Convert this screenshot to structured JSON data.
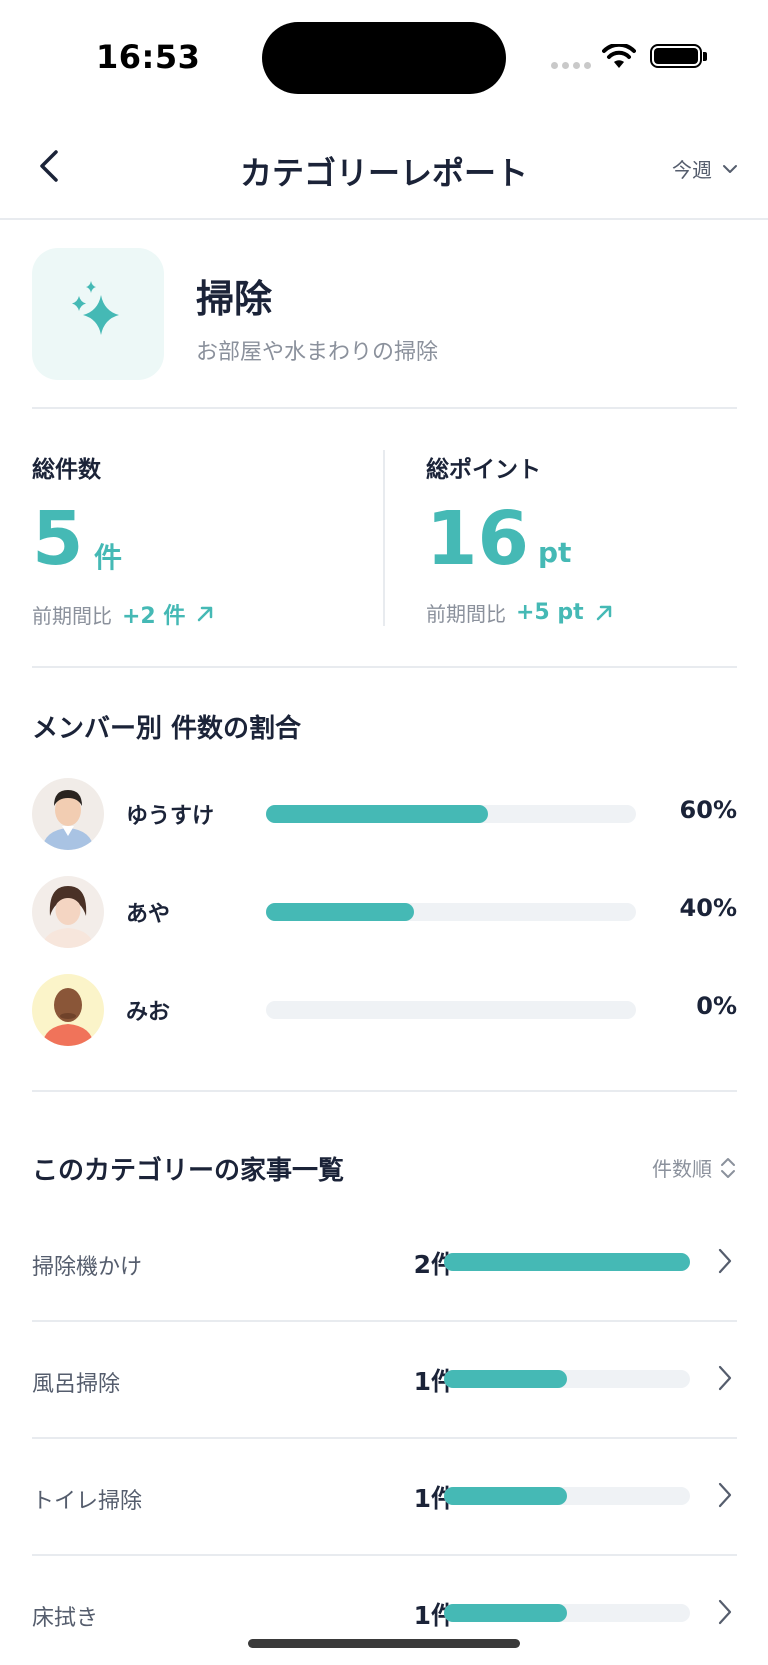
{
  "status_bar": {
    "time": "16:53"
  },
  "header": {
    "title": "カテゴリーレポート",
    "period": "今週"
  },
  "category": {
    "name": "掃除",
    "description": "お部屋や水まわりの掃除",
    "accent": "#45b9b5"
  },
  "stats": {
    "total_count": {
      "label": "総件数",
      "value": "5",
      "unit": "件",
      "compare_label": "前期間比",
      "delta": "+2 件"
    },
    "total_points": {
      "label": "総ポイント",
      "value": "16",
      "unit": "pt",
      "compare_label": "前期間比",
      "delta": "+5 pt"
    }
  },
  "members_section": {
    "title": "メンバー別 件数の割合",
    "members": [
      {
        "name": "ゆうすけ",
        "percent": "60%",
        "ratio": 0.6
      },
      {
        "name": "あや",
        "percent": "40%",
        "ratio": 0.4
      },
      {
        "name": "みお",
        "percent": "0%",
        "ratio": 0
      }
    ]
  },
  "chores_section": {
    "title": "このカテゴリーの家事一覧",
    "sort": "件数順",
    "items": [
      {
        "name": "掃除機かけ",
        "count": "2件",
        "ratio": 1.0
      },
      {
        "name": "風呂掃除",
        "count": "1件",
        "ratio": 0.5
      },
      {
        "name": "トイレ掃除",
        "count": "1件",
        "ratio": 0.5
      },
      {
        "name": "床拭き",
        "count": "1件",
        "ratio": 0.5
      }
    ]
  }
}
